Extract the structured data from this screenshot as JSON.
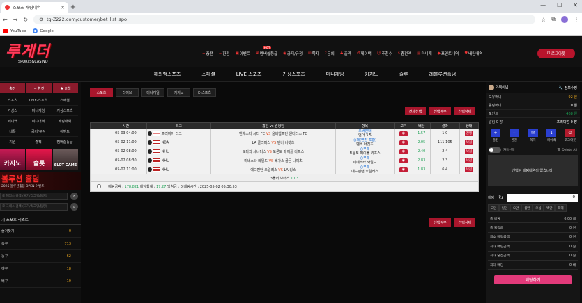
{
  "browser": {
    "tab_title": "스포츠 배팅내역",
    "url": "tg-Z222.com/customer/bet_list_spo",
    "bookmarks": [
      "YouTube",
      "Google"
    ]
  },
  "site": {
    "logo": "루게더",
    "logo_sub": "SPORTS&CASINO",
    "logout": "로그아웃",
    "topnav": [
      {
        "icon": "+",
        "label": "충전"
      },
      {
        "icon": "−",
        "label": "환전"
      },
      {
        "icon": "▣",
        "label": "이벤트"
      },
      {
        "icon": "♛",
        "label": "멤버쉽등급"
      },
      {
        "icon": "◉",
        "label": "공지/규정"
      },
      {
        "icon": "✉",
        "label": "쪽지"
      },
      {
        "icon": "?",
        "label": "문의"
      },
      {
        "icon": "♣",
        "label": "출첵"
      },
      {
        "icon": "↺",
        "label": "페이백"
      },
      {
        "icon": "☺",
        "label": "추천수"
      },
      {
        "icon": "$",
        "label": "충전액"
      },
      {
        "icon": "▤",
        "label": "마니패"
      },
      {
        "icon": "◆",
        "label": "포인트내역"
      },
      {
        "icon": "♥",
        "label": "배팅내역"
      }
    ],
    "topnav_badge": "HOT",
    "mainnav": [
      "해외형스포츠",
      "스페셜",
      "LIVE 스포츠",
      "가상스포츠",
      "미니게임",
      "카지노",
      "슬롯",
      "레볼루션홀덤"
    ]
  },
  "sidebar": {
    "buttons": [
      "충전",
      "− 환전",
      "♣ 출첵"
    ],
    "grid": [
      "스포츠",
      "LIVE-스포츠",
      "스페셜",
      "가상스",
      "미니게임",
      "가상스포츠",
      "페이백",
      "미니내역",
      "배팅내역",
      "내쪽",
      "공지/규정",
      "이벤트",
      "지원",
      "출첵",
      "멤버쉽등급"
    ],
    "banners": [
      "카지노",
      "슬롯",
      "SLOT GAME"
    ],
    "event_title": "볼루션 홀덤",
    "event_sub": "2025 볼루션홀덤 OPEN 이벤트",
    "search1": "로 해외스 검색 (국가/리그명/팀명)",
    "search2": "로 국내스 검색 (국가/리그명/팀명)",
    "list_title": "기 스포츠 리스트",
    "sports": [
      {
        "name": "즐겨찾기",
        "count": "0"
      },
      {
        "name": "축구",
        "count": "713"
      },
      {
        "name": "농구",
        "count": "62"
      },
      {
        "name": "야구",
        "count": "18"
      },
      {
        "name": "배구",
        "count": "10"
      }
    ]
  },
  "content": {
    "tabs": [
      "스포츠",
      "라이브",
      "미니게임",
      "카지노",
      "E-스포츠"
    ],
    "actions_top": [
      "전체선택",
      "선택정부",
      "선택삭제"
    ],
    "actions_bottom": [
      "선택정부",
      "선택삭제"
    ],
    "headers": [
      "시간",
      "리그",
      "홈팀 vs 원정팀",
      "항목",
      "보기",
      "배당",
      "결과",
      "상태"
    ],
    "rows": [
      {
        "time": "05-03 04:00",
        "league": "프리미어 리그",
        "flag": "eng",
        "home": "맨체스터 시티 FC",
        "away": "울버햄프턴 원더러스 FC",
        "pick1": "오버언더",
        "pick2": "언더 3.5",
        "odds": "1.57",
        "result": "1:0",
        "status": "진행"
      },
      {
        "time": "05-02 11:00",
        "league": "NBA",
        "flag": "us",
        "home": "LA 클리퍼스",
        "away": "덴버 너겟츠",
        "pick1": "승패(연장 포함)",
        "pick2": "덴버 너겟츠",
        "odds": "2.05",
        "result": "111:105",
        "status": "낙첨"
      },
      {
        "time": "05-02 08:00",
        "league": "NHL",
        "flag": "us",
        "home": "오타와 세너터스",
        "away": "토론토 메이플 리프스",
        "pick1": "승무패",
        "pick2": "토론토 메이플 리프스",
        "odds": "2.40",
        "result": "2:4",
        "status": "낙첨"
      },
      {
        "time": "05-02 08:30",
        "league": "NHL",
        "flag": "us",
        "home": "미네소타 와일드",
        "away": "베가스 골든 나이츠",
        "pick1": "승무패",
        "pick2": "미네소타 와일드",
        "odds": "2.83",
        "result": "2:3",
        "status": "낙첨"
      },
      {
        "time": "05-02 11:00",
        "league": "NHL",
        "flag": "us",
        "home": "에드먼턴 오일러스",
        "away": "LA 킹스",
        "pick1": "승무패",
        "pick2": "에드먼턴 오일러스",
        "odds": "1.83",
        "result": "6:4",
        "status": "낙첨"
      }
    ],
    "vs": "VS",
    "bonus_label": "3폴더 보너스",
    "bonus_value": "1.03",
    "summary": {
      "amount_label": "배팅금액 :",
      "amount": "178,821",
      "total_odds_label": "배당합계 :",
      "total_odds": "17.27",
      "win_label": "당첨금 :",
      "win": "0",
      "date_label": "배팅시간 :",
      "date": "2025-05-02 05:30:53"
    }
  },
  "right": {
    "user": "가목이님",
    "info": "정보수정",
    "lines": [
      {
        "label": "보유머니",
        "value": "92 원",
        "cls": "o"
      },
      {
        "label": "롤링머니",
        "value": "0 원",
        "cls": ""
      },
      {
        "label": "포인트",
        "value": "468 원",
        "cls": "g"
      },
      {
        "label": "알림 0 장",
        "value": "프리미엄 0 장",
        "cls": ""
      }
    ],
    "icons": [
      {
        "b": "+",
        "label": "충전"
      },
      {
        "b": "−",
        "label": "환전"
      },
      {
        "b": "✉",
        "label": "쪽지"
      },
      {
        "b": "↓",
        "label": "페이백"
      },
      {
        "b": "⏻",
        "label": "로그아웃"
      }
    ],
    "toggle_label": "자동선택",
    "delete_all": "Delete All",
    "slip_empty": "선택된 배팅내역이 없습니다.",
    "amount_label": "배팅",
    "amount_value": "0",
    "amounts": [
      "오만",
      "일만",
      "오만",
      "십만",
      "오십",
      "백만",
      "최대"
    ],
    "stats": [
      {
        "label": "총 배당",
        "value": "0.00 배"
      },
      {
        "label": "총 당첨금",
        "value": "0 원"
      },
      {
        "label": "최소 배팅금액",
        "value": "0 원"
      },
      {
        "label": "최대 배팅금액",
        "value": "0 원"
      },
      {
        "label": "최대 당첨금액",
        "value": "0 원"
      },
      {
        "label": "최대 배당",
        "value": "0 배"
      }
    ],
    "bet_button": "배팅하기"
  }
}
